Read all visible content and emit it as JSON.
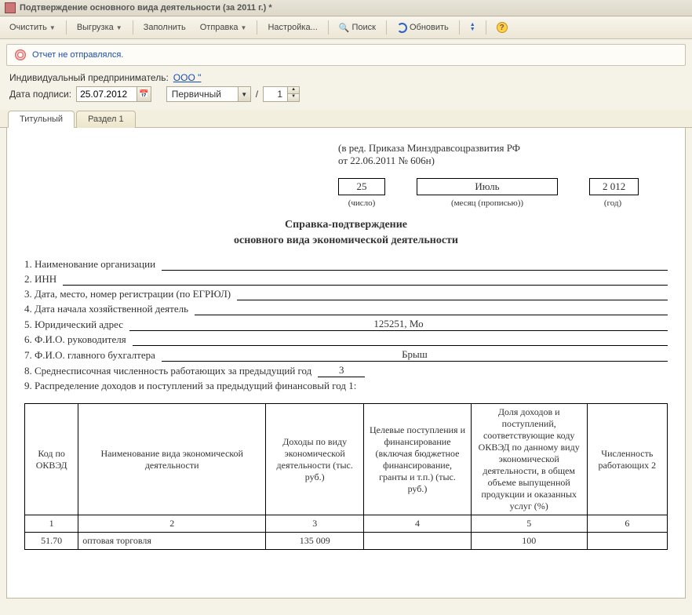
{
  "window": {
    "title": "Подтверждение основного вида деятельности  (за 2011 г.) *"
  },
  "toolbar": {
    "clear": "Очистить",
    "export": "Выгрузка",
    "fill": "Заполнить",
    "send": "Отправка",
    "settings": "Настройка...",
    "search": "Поиск",
    "refresh": "Обновить"
  },
  "status": {
    "text": "Отчет не отправлялся."
  },
  "meta": {
    "entrepreneur_label": "Индивидуальный предприниматель:",
    "entrepreneur_value": "ООО \"",
    "sign_date_label": "Дата подписи:",
    "sign_date_value": "25.07.2012",
    "kind_value": "Первичный",
    "slash": "/",
    "corr_value": "1"
  },
  "tabs": [
    {
      "label": "Титульный",
      "active": true
    },
    {
      "label": "Раздел 1",
      "active": false
    }
  ],
  "doc": {
    "reg_line1": "(в ред. Приказа Минздравсоцразвития РФ",
    "reg_line2": "от 22.06.2011 № 606н)",
    "date": {
      "day": "25",
      "month": "Июль",
      "year": "2 012"
    },
    "captions": {
      "day": "(число)",
      "month": "(месяц (прописью))",
      "year": "(год)"
    },
    "title": "Справка-подтверждение",
    "subtitle": "основного вида экономической деятельности",
    "lines": {
      "l1_label": "1. Наименование организации",
      "l1_value": "",
      "l2_label": "2. ИНН",
      "l2_value": "",
      "l3_label": "3. Дата, место, номер регистрации (по ЕГРЮЛ)",
      "l3_value": "",
      "l4_label": "4. Дата начала хозяйственной деятель",
      "l4_value": "",
      "l5_label": "5. Юридический адрес",
      "l5_value": "125251, Мо",
      "l6_label": "6. Ф.И.О. руководителя",
      "l6_value": "",
      "l7_label": "7. Ф.И.О. главного бухгалтера",
      "l7_value": "Брыш",
      "l8_label": "8. Среднесписочная численность работающих за предыдущий год",
      "l8_value": "3",
      "l9_label": "9. Распределение доходов и поступлений за предыдущий финансовый год 1:"
    },
    "table": {
      "headers": [
        "Код по ОКВЭД",
        "Наименование вида экономической деятельности",
        "Доходы по виду экономической деятельности (тыс. руб.)",
        "Целевые пос­тупления и фи­нансирование (включая бюд­жетное фи­нансирование, гранты и т.п.) (тыс. руб.)",
        "Доля доходов и поступлений, соответствующие коду ОКВЭД по данному виду экономической деятельности, в общем объеме выпущенной продукции и оказанных услуг (%)",
        "Численность работающих 2"
      ],
      "numrow": [
        "1",
        "2",
        "3",
        "4",
        "5",
        "6"
      ],
      "rows": [
        {
          "code": "51.70",
          "name": "оптовая торговля",
          "income": "135 009",
          "target": "",
          "share": "100",
          "count": ""
        }
      ]
    }
  }
}
